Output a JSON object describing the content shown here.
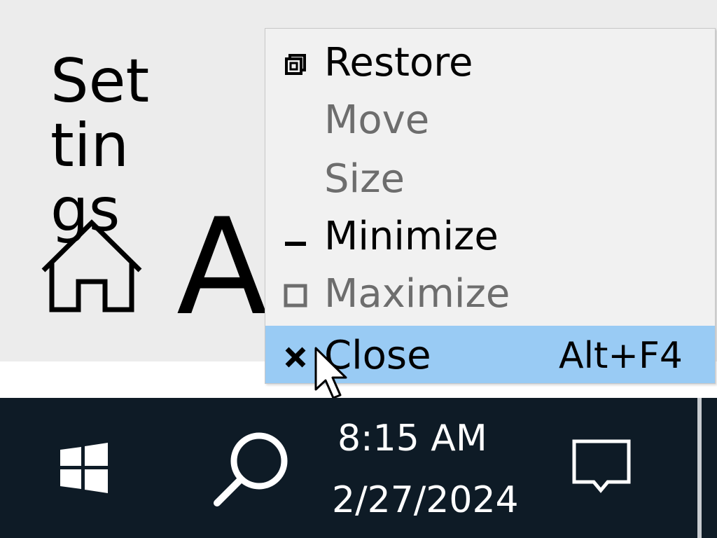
{
  "window": {
    "title_lines": [
      "Set",
      "tin",
      "gs"
    ],
    "page_letter": "A",
    "home_icon": "home-icon"
  },
  "context_menu": {
    "items": [
      {
        "label": "Restore",
        "icon": "restore-icon",
        "enabled": true,
        "shortcut": ""
      },
      {
        "label": "Move",
        "icon": "",
        "enabled": false,
        "shortcut": ""
      },
      {
        "label": "Size",
        "icon": "",
        "enabled": false,
        "shortcut": ""
      },
      {
        "label": "Minimize",
        "icon": "minimize-icon",
        "enabled": true,
        "shortcut": ""
      },
      {
        "label": "Maximize",
        "icon": "maximize-icon",
        "enabled": false,
        "shortcut": ""
      },
      {
        "label": "Close",
        "icon": "close-icon",
        "enabled": true,
        "shortcut": "Alt+F4",
        "highlighted": true
      }
    ],
    "highlight_color": "#99cbf4"
  },
  "taskbar": {
    "background": "#0e1b26",
    "start_icon": "windows-logo-icon",
    "search_icon": "search-icon",
    "clock_time": "8:15 AM",
    "clock_date": "2/27/2024",
    "notification_icon": "action-center-icon"
  }
}
